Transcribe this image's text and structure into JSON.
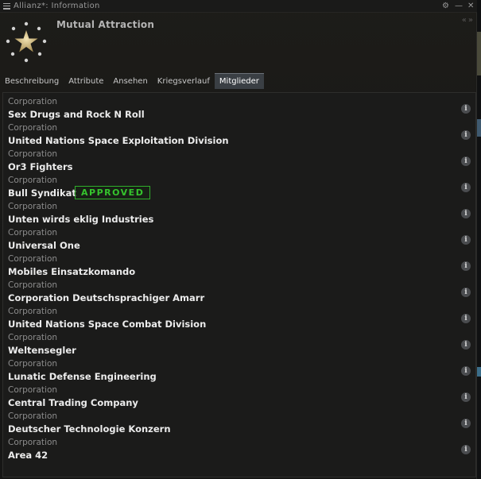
{
  "window": {
    "title": "Allianz*: Information",
    "controls": {
      "settings_icon": "gear-icon",
      "minimize_icon": "minimize-icon",
      "close_icon": "close-icon"
    }
  },
  "header": {
    "alliance_name": "Mutual Attraction",
    "emblem_icon": "alliance-star-logo",
    "nav_back_icon": "double-chevron-left-icon",
    "nav_forward_icon": "double-chevron-right-icon"
  },
  "tabs": [
    {
      "label": "Beschreibung",
      "active": false
    },
    {
      "label": "Attribute",
      "active": false
    },
    {
      "label": "Ansehen",
      "active": false
    },
    {
      "label": "Kriegsverlauf",
      "active": false
    },
    {
      "label": "Mitglieder",
      "active": true
    }
  ],
  "members": [
    {
      "type": "Corporation",
      "name": "Sex Drugs and Rock N Roll"
    },
    {
      "type": "Corporation",
      "name": "United Nations Space Exploitation Division"
    },
    {
      "type": "Corporation",
      "name": "Or3 Fighters"
    },
    {
      "type": "Corporation",
      "name": "Bull Syndikat",
      "badge": "APPROVED"
    },
    {
      "type": "Corporation",
      "name": "Unten wirds eklig Industries"
    },
    {
      "type": "Corporation",
      "name": "Universal One"
    },
    {
      "type": "Corporation",
      "name": "Mobiles Einsatzkomando"
    },
    {
      "type": "Corporation",
      "name": "Corporation Deutschsprachiger Amarr"
    },
    {
      "type": "Corporation",
      "name": "United Nations Space Combat Division"
    },
    {
      "type": "Corporation",
      "name": "Weltensegler"
    },
    {
      "type": "Corporation",
      "name": "Lunatic Defense Engineering"
    },
    {
      "type": "Corporation",
      "name": "Central Trading Company"
    },
    {
      "type": "Corporation",
      "name": "Deutscher Technologie Konzern"
    },
    {
      "type": "Corporation",
      "name": "Area 42"
    }
  ],
  "info_glyph": "i",
  "colors": {
    "approved": "#35c52d",
    "active_tab": "#3a3f44"
  }
}
